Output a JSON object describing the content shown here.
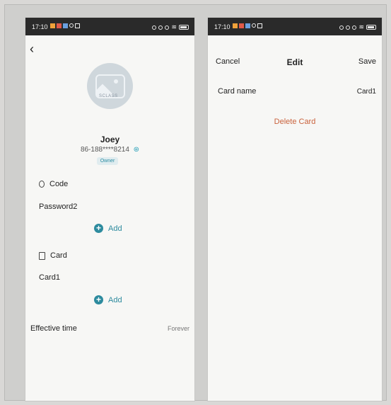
{
  "colors": {
    "accent": "#2d8b9e",
    "danger": "#c9623c",
    "statusbar": "#2a2a2a",
    "badge_bg": "#e0ecef"
  },
  "left_screen": {
    "status_time": "17:10",
    "back_icon": "chevron-left-icon",
    "avatar_logo": "SCLASS",
    "user": {
      "name": "Joey",
      "phone": "86-188****8214",
      "role": "Owner"
    },
    "code_section": {
      "label": "Code",
      "items": [
        "Password2"
      ],
      "add_label": "Add"
    },
    "card_section": {
      "label": "Card",
      "items": [
        "Card1"
      ],
      "add_label": "Add"
    },
    "effective_time": {
      "label": "Effective time",
      "value": "Forever"
    }
  },
  "right_screen": {
    "status_time": "17:10",
    "nav": {
      "cancel": "Cancel",
      "title": "Edit",
      "save": "Save"
    },
    "card_name": {
      "label": "Card name",
      "value": "Card1"
    },
    "delete_label": "Delete Card"
  }
}
